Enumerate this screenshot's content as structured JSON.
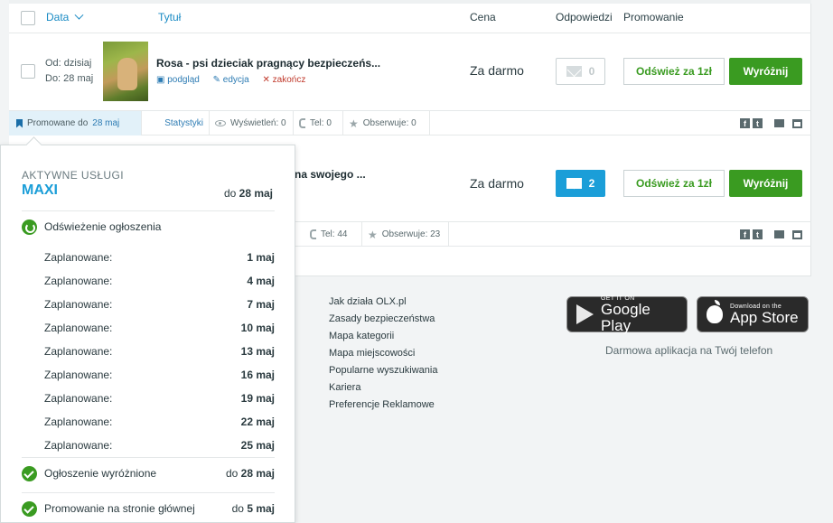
{
  "table": {
    "headers": {
      "date": "Data",
      "title": "Tytuł",
      "price": "Cena",
      "responses": "Odpowiedzi",
      "promotion": "Promowanie"
    }
  },
  "ads": [
    {
      "date_from": "Od: dzisiaj",
      "date_to": "Do: 28 maj",
      "title": "Rosa - psi dzieciak pragnący bezpieczeńs...",
      "link_preview": "podgląd",
      "link_edit": "edycja",
      "link_end": "zakończ",
      "price": "Za darmo",
      "responses": "0",
      "refresh_label": "Odśwież za 1zł",
      "feature_label": "Wyróżnij",
      "promo_prefix": "Promowane do",
      "promo_date": "28 maj",
      "stats_link": "Statystyki",
      "views": "Wyświetleń: 0",
      "phone": "Tel: 0",
      "watching": "Obserwuje: 0"
    },
    {
      "title_partial": "na swojego ...",
      "price": "Za darmo",
      "responses": "2",
      "refresh_label": "Odśwież za 1zł",
      "feature_label": "Wyróżnij",
      "phone": "Tel: 44",
      "watching": "Obserwuje: 23"
    }
  ],
  "popup": {
    "label": "AKTYWNE USŁUGI",
    "package": "MAXI",
    "until_prefix": "do",
    "until_date": "28 maj",
    "refresh_title": "Odświeżenie ogłoszenia",
    "schedule_label": "Zaplanowane:",
    "schedule": [
      "1 maj",
      "4 maj",
      "7 maj",
      "10 maj",
      "13 maj",
      "16 maj",
      "19 maj",
      "22 maj",
      "25 maj"
    ],
    "featured_title": "Ogłoszenie wyróżnione",
    "featured_until": "do 28 maj",
    "homepage_title": "Promowanie na stronie głównej",
    "homepage_until": "do 5 maj"
  },
  "footer": {
    "links": [
      "Jak działa OLX.pl",
      "Zasady bezpieczeństwa",
      "Mapa kategorii",
      "Mapa miejscowości",
      "Popularne wyszukiwania",
      "Kariera",
      "Preferencje Reklamowe"
    ],
    "google_small": "GET IT ON",
    "google_big": "Google Play",
    "apple_small": "Download on the",
    "apple_big": "App Store",
    "app_caption": "Darmowa aplikacja na Twój telefon"
  },
  "colors": {
    "accent_blue": "#1b9ed8",
    "green": "#3a9b21",
    "link": "#2c7bb3"
  }
}
